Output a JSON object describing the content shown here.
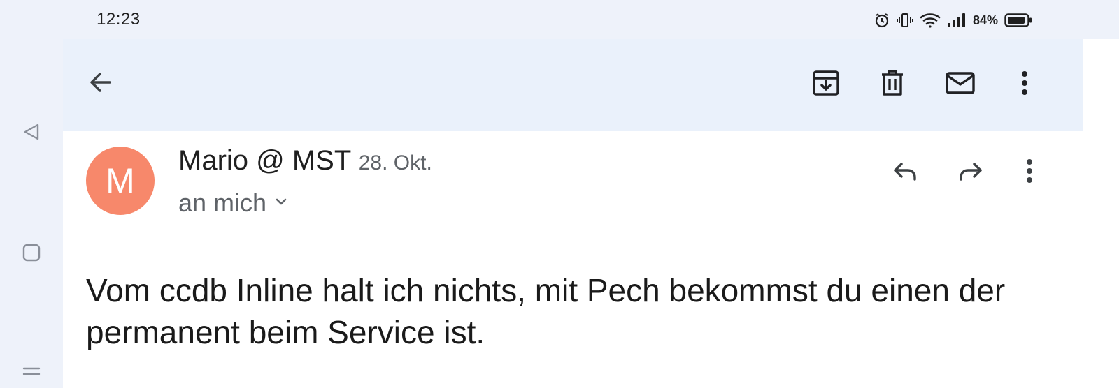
{
  "status_bar": {
    "time": "12:23",
    "battery_percent": "84%",
    "icons": [
      "alarm-icon",
      "vibrate-icon",
      "wifi-icon",
      "signal-icon",
      "battery-icon"
    ]
  },
  "left_nav": {
    "icons": [
      "back-triangle-icon",
      "home-square-icon",
      "menu-lines-icon"
    ]
  },
  "toolbar": {
    "icons": [
      "back-arrow-icon",
      "archive-icon",
      "delete-icon",
      "mark-unread-icon",
      "more-vert-icon"
    ]
  },
  "message": {
    "avatar_letter": "M",
    "avatar_color": "#f7886b",
    "sender": "Mario @ MST",
    "date": "28. Okt.",
    "recipient": "an mich",
    "actions": [
      "reply-icon",
      "forward-icon",
      "more-vert-icon"
    ],
    "body": "Vom ccdb Inline halt ich nichts, mit Pech bekommst du einen der permanent beim Service ist."
  }
}
